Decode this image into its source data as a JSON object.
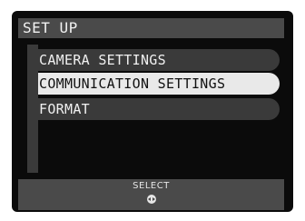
{
  "title": "SET UP",
  "menu": {
    "items": [
      {
        "label": "CAMERA SETTINGS",
        "selected": false
      },
      {
        "label": "COMMUNICATION SETTINGS",
        "selected": true
      },
      {
        "label": "FORMAT",
        "selected": false
      }
    ]
  },
  "footer": {
    "label": "SELECT",
    "icon": "dial-left-right-icon"
  },
  "colors": {
    "screen_bg": "#0b0b0b",
    "bar_gray": "#4a4a4a",
    "item_gray": "#3a3a3a",
    "selected_bg": "#e9e9e9",
    "text_light": "#f0f0f0",
    "text_dark": "#111111"
  }
}
